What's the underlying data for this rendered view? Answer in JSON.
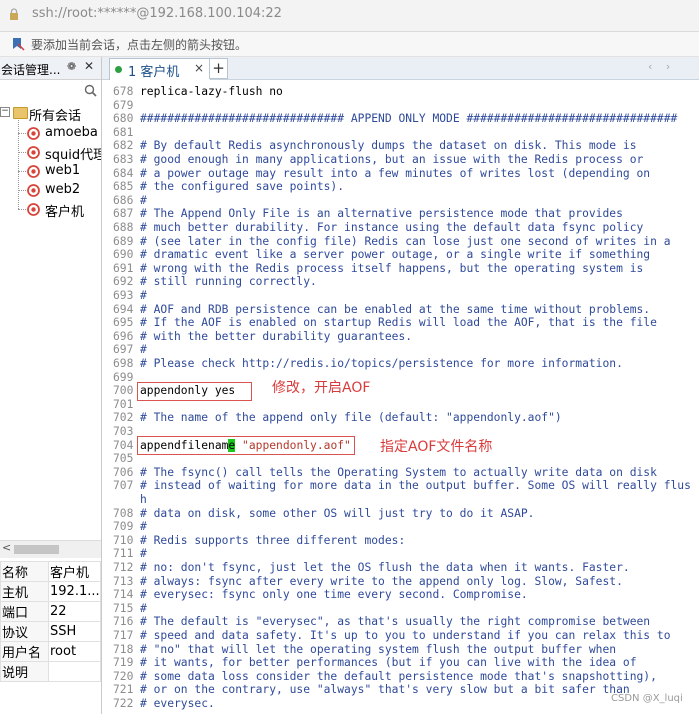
{
  "address_bar": {
    "text": "ssh://root:******@192.168.100.104:22"
  },
  "hint_bar": {
    "text": "要添加当前会话，点击左侧的箭头按钮。"
  },
  "left_panel": {
    "title": "会话管理...",
    "pin_glyph": "❁",
    "close_glyph": "✕",
    "root_label": "所有会话",
    "sessions": [
      "amoeba",
      "squid代理",
      "web1",
      "web2",
      "客户机"
    ],
    "properties": [
      {
        "key": "名称",
        "value": "客户机"
      },
      {
        "key": "主机",
        "value": "192.1..."
      },
      {
        "key": "端口",
        "value": "22"
      },
      {
        "key": "协议",
        "value": "SSH"
      },
      {
        "key": "用户名",
        "value": "root"
      },
      {
        "key": "说明",
        "value": ""
      }
    ]
  },
  "tabs": {
    "active_label": "1 客户机",
    "close_glyph": "×",
    "add_glyph": "+",
    "nav_glyphs": "‹ ›"
  },
  "terminal": {
    "lines": [
      {
        "n": "678",
        "t": "replica-lazy-flush no",
        "c": false
      },
      {
        "n": "679",
        "t": "",
        "c": false
      },
      {
        "n": "680",
        "t": "############################## APPEND ONLY MODE ###############################",
        "c": true
      },
      {
        "n": "681",
        "t": "",
        "c": false
      },
      {
        "n": "682",
        "t": "# By default Redis asynchronously dumps the dataset on disk. This mode is",
        "c": true
      },
      {
        "n": "683",
        "t": "# good enough in many applications, but an issue with the Redis process or",
        "c": true
      },
      {
        "n": "684",
        "t": "# a power outage may result into a few minutes of writes lost (depending on",
        "c": true
      },
      {
        "n": "685",
        "t": "# the configured save points).",
        "c": true
      },
      {
        "n": "686",
        "t": "#",
        "c": true
      },
      {
        "n": "687",
        "t": "# The Append Only File is an alternative persistence mode that provides",
        "c": true
      },
      {
        "n": "688",
        "t": "# much better durability. For instance using the default data fsync policy",
        "c": true
      },
      {
        "n": "689",
        "t": "# (see later in the config file) Redis can lose just one second of writes in a",
        "c": true
      },
      {
        "n": "690",
        "t": "# dramatic event like a server power outage, or a single write if something",
        "c": true
      },
      {
        "n": "691",
        "t": "# wrong with the Redis process itself happens, but the operating system is",
        "c": true
      },
      {
        "n": "692",
        "t": "# still running correctly.",
        "c": true
      },
      {
        "n": "693",
        "t": "#",
        "c": true
      },
      {
        "n": "694",
        "t": "# AOF and RDB persistence can be enabled at the same time without problems.",
        "c": true
      },
      {
        "n": "695",
        "t": "# If the AOF is enabled on startup Redis will load the AOF, that is the file",
        "c": true
      },
      {
        "n": "696",
        "t": "# with the better durability guarantees.",
        "c": true
      },
      {
        "n": "697",
        "t": "#",
        "c": true
      },
      {
        "n": "698",
        "t": "# Please check http://redis.io/topics/persistence for more information.",
        "c": true
      },
      {
        "n": "699",
        "t": "",
        "c": false
      },
      {
        "n": "700",
        "t": "appendonly yes",
        "c": false
      },
      {
        "n": "701",
        "t": "",
        "c": false
      },
      {
        "n": "702",
        "t": "# The name of the append only file (default: \"appendonly.aof\")",
        "c": true
      },
      {
        "n": "703",
        "t": "",
        "c": false
      },
      {
        "n": "704",
        "t": "",
        "c": false
      },
      {
        "n": "705",
        "t": "",
        "c": false
      },
      {
        "n": "706",
        "t": "# The fsync() call tells the Operating System to actually write data on disk",
        "c": true
      },
      {
        "n": "707",
        "t": "# instead of waiting for more data in the output buffer. Some OS will really flus",
        "c": true
      },
      {
        "n": "",
        "t": "h",
        "c": true
      },
      {
        "n": "708",
        "t": "# data on disk, some other OS will just try to do it ASAP.",
        "c": true
      },
      {
        "n": "709",
        "t": "#",
        "c": true
      },
      {
        "n": "710",
        "t": "# Redis supports three different modes:",
        "c": true
      },
      {
        "n": "711",
        "t": "#",
        "c": true
      },
      {
        "n": "712",
        "t": "# no: don't fsync, just let the OS flush the data when it wants. Faster.",
        "c": true
      },
      {
        "n": "713",
        "t": "# always: fsync after every write to the append only log. Slow, Safest.",
        "c": true
      },
      {
        "n": "714",
        "t": "# everysec: fsync only one time every second. Compromise.",
        "c": true
      },
      {
        "n": "715",
        "t": "#",
        "c": true
      },
      {
        "n": "716",
        "t": "# The default is \"everysec\", as that's usually the right compromise between",
        "c": true
      },
      {
        "n": "717",
        "t": "# speed and data safety. It's up to you to understand if you can relax this to",
        "c": true
      },
      {
        "n": "718",
        "t": "# \"no\" that will let the operating system flush the output buffer when",
        "c": true
      },
      {
        "n": "719",
        "t": "# it wants, for better performances (but if you can live with the idea of",
        "c": true
      },
      {
        "n": "720",
        "t": "# some data loss consider the default persistence mode that's snapshotting),",
        "c": true
      },
      {
        "n": "721",
        "t": "# or on the contrary, use \"always\" that's very slow but a bit safer than",
        "c": true
      },
      {
        "n": "722",
        "t": "# everysec.",
        "c": true
      }
    ],
    "line704": {
      "key_before": "appendfilenam",
      "cursor_char": "e",
      "value": " \"appendonly.aof\""
    }
  },
  "annotations": {
    "a1": "修改，开启AOF",
    "a2": "指定AOF文件名称"
  },
  "watermark": "CSDN @X_luqi",
  "colors": {
    "annotation": "#d93b3b",
    "comment": "#2f4a9a",
    "string": "#b5382b",
    "cursor": "#1ac71a",
    "tab_dot": "#2ea043"
  }
}
